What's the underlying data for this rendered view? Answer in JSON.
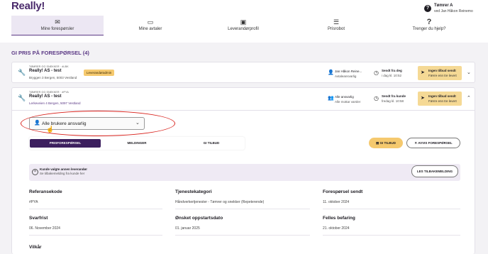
{
  "app": {
    "logo": "Really!",
    "user_name": "Tømrer A",
    "user_sub": "ved Jan Håkon Reinemo",
    "user_icon": "help-circle-icon"
  },
  "nav": [
    {
      "label": "Mine forespørsler",
      "icon": "inbox-icon",
      "glyph": "✉"
    },
    {
      "label": "Mine avtaler",
      "icon": "tray-icon",
      "glyph": "▭"
    },
    {
      "label": "Leverandørprofil",
      "icon": "profile-card-icon",
      "glyph": "▣"
    },
    {
      "label": "Prisrobot",
      "icon": "sliders-icon",
      "glyph": "☰"
    },
    {
      "label": "Trenger du hjelp?",
      "icon": "question-icon",
      "glyph": "?"
    }
  ],
  "section_title": "GI PRIS PÅ FORESPØRSEL (4)",
  "requests": [
    {
      "category": "TØMRER OG SNEKKER · #LBK",
      "company": "Really! AS - test",
      "address": "Bryggen 3 Bergen, 5003 Vestland",
      "badge": "Leverandøradmin",
      "person": "Jan Håkon Reine...",
      "person_sub": "Avtaleansvarlig",
      "sent_label": "Sendt fra deg",
      "sent_sub": "i dag kl. 10:52",
      "offer_line1": "Ingen tilbud sendt",
      "offer_line2": "Færre enn tre levert"
    },
    {
      "category": "TØMRER OG SNEKKER · #PYA",
      "company": "Really! AS - test",
      "address": "Lerkeveien 4 Bergen, 5097 Vestland",
      "person": "Alle ansvarlig",
      "person_sub": "Alle mottar varsler",
      "sent_label": "Sendt fra kunde",
      "sent_sub": "fredag kl. 10:58",
      "offer_line1": "Ingen tilbud sendt",
      "offer_line2": "Færre enn tre levert"
    }
  ],
  "assign_select": {
    "value": "Alle brukere ansvarlig"
  },
  "subtabs": [
    "PRISFORESPØRSEL",
    "MELDINGER",
    "GI TILBUD"
  ],
  "actions": {
    "give_offer": "GI TILBUD",
    "reject": "AVVIS FORESPØRSEL"
  },
  "notice": {
    "title": "Kunde valgte annen leverandør",
    "text": "Se tilbakemelding fra kunde her",
    "button": "LES TILBAKEMELDING"
  },
  "fields": [
    {
      "label": "Referansekode",
      "value": "#PYA"
    },
    {
      "label": "Tjenestekategori",
      "value": "Håndverkertjenester - Tømrer og snekker (Repeterende)"
    },
    {
      "label": "Forespørsel sendt",
      "value": "11. oktober 2024"
    },
    {
      "label": "Svarfrist",
      "value": "06. November 2024"
    },
    {
      "label": "Ønsket oppstartsdato",
      "value": "01. januar 2025"
    },
    {
      "label": "Felles befaring",
      "value": "21. oktober 2024"
    },
    {
      "label": "Vilkår",
      "value": ""
    }
  ],
  "colors": {
    "brand": "#5c3a86",
    "accent": "#f5c96e",
    "annotation": "#d9231d"
  }
}
